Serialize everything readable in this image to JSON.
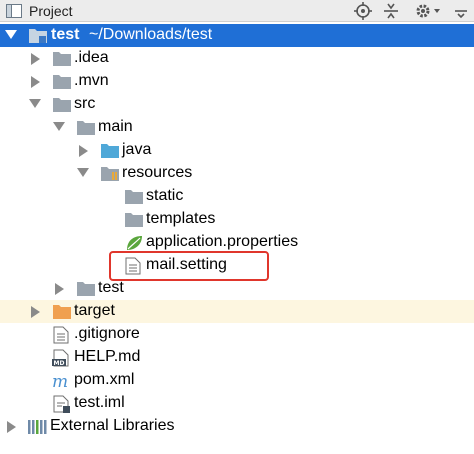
{
  "panel": {
    "title": "Project"
  },
  "toolbar_icons": [
    "crosshair-icon",
    "collapse-icon",
    "gear-icon",
    "hide-icon"
  ],
  "tree": {
    "root_name": "test",
    "root_path": "~/Downloads/test",
    "idea": ".idea",
    "mvn": ".mvn",
    "src": "src",
    "main": "main",
    "java": "java",
    "resources": "resources",
    "static": "static",
    "templates": "templates",
    "application_properties": "application.properties",
    "mail_setting": "mail.setting",
    "test_dir": "test",
    "target": "target",
    "gitignore": ".gitignore",
    "help_md": "HELP.md",
    "pom_xml": "pom.xml",
    "test_iml": "test.iml",
    "external_libraries": "External Libraries"
  },
  "colors": {
    "selection": "#1f6fd6",
    "folder": "#9aa4ae",
    "java_folder": "#4fa8d8",
    "target_folder": "#f0a050",
    "highlight": "#e0362c"
  }
}
